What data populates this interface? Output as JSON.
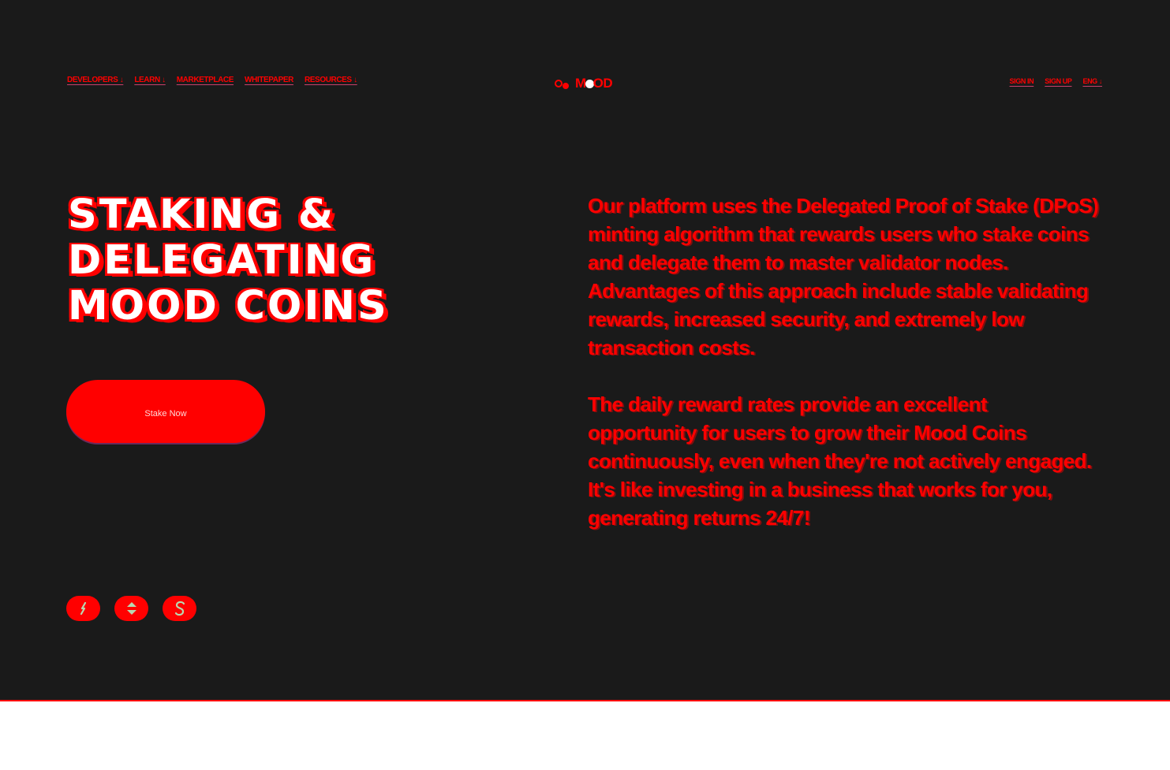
{
  "nav": {
    "left": [
      {
        "label": "DEVELOPERS ↓"
      },
      {
        "label": "LEARN ↓"
      },
      {
        "label": "MARKETPLACE"
      },
      {
        "label": "WHITEPAPER"
      },
      {
        "label": "RESOURCES ↓"
      }
    ],
    "logo_text_pre": "M",
    "logo_text_post": "OD",
    "right": [
      {
        "label": "SIGN IN"
      },
      {
        "label": "SIGN UP"
      },
      {
        "label": "ENG ↓"
      }
    ]
  },
  "hero": {
    "title_line1": "STAKING &",
    "title_line2": "DELEGATING",
    "title_line3": "MOOD COINS",
    "cta_label": "Stake Now"
  },
  "content": {
    "paragraph1": "Our platform uses the Delegated Proof of Stake (DPoS) minting algorithm that rewards users who stake coins and delegate them to master validator nodes. Advantages of this approach include stable validating rewards, increased security, and extremely low transaction costs.",
    "paragraph2": "The daily reward rates provide an excellent opportunity for users to grow their Mood Coins continuously, even when they're not actively engaged. It's like investing in a business that works for you, generating returns 24/7!"
  },
  "socials": [
    {
      "icon": "telegram-icon"
    },
    {
      "icon": "twitter-icon"
    },
    {
      "icon": "discord-icon"
    }
  ],
  "colors": {
    "background": "#1a1a1a",
    "accent": "#ff0000",
    "title_fill": "#ffffff"
  }
}
